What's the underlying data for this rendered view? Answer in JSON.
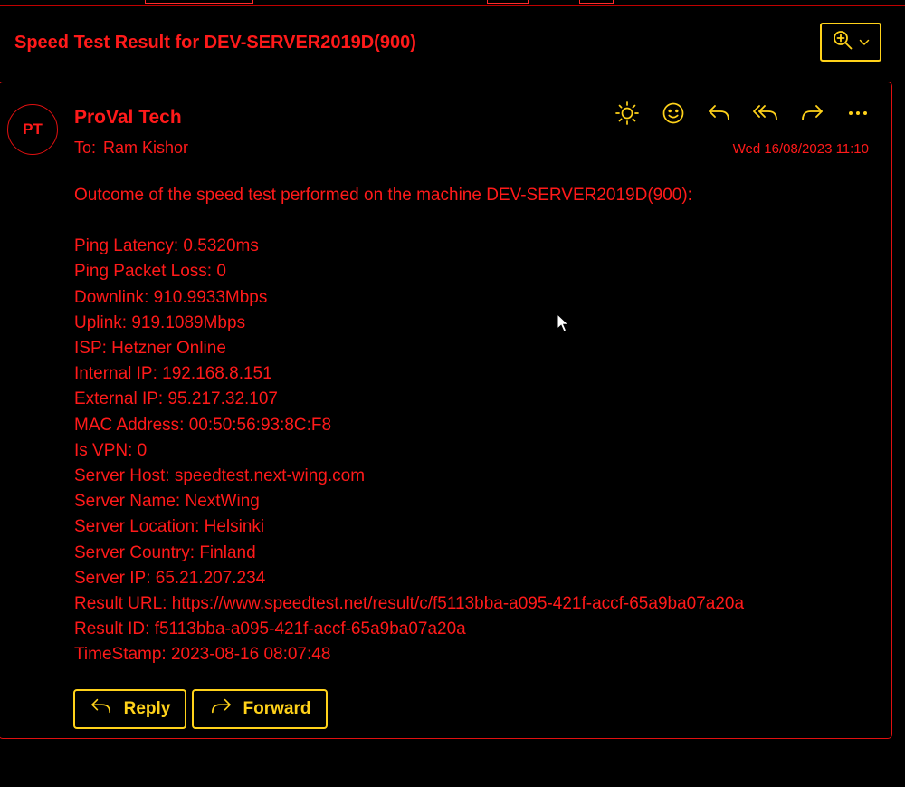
{
  "email": {
    "subject": "Speed Test Result for DEV-SERVER2019D(900)",
    "avatar_initials": "PT",
    "sender": "ProVal Tech",
    "to_label": "To:",
    "to_name": "Ram Kishor",
    "date": "Wed 16/08/2023 11:10",
    "intro": "Outcome of the speed test performed on the machine DEV-SERVER2019D(900):",
    "lines": [
      "Ping Latency: 0.5320ms",
      "Ping Packet Loss: 0",
      "Downlink: 910.9933Mbps",
      "Uplink: 919.1089Mbps",
      "ISP: Hetzner Online",
      "Internal IP: 192.168.8.151",
      "External IP: 95.217.32.107",
      "MAC Address: 00:50:56:93:8C:F8",
      "Is VPN: 0",
      "Server Host: speedtest.next-wing.com",
      "Server Name: NextWing",
      "Server Location: Helsinki",
      "Server Country: Finland",
      "Server IP: 65.21.207.234",
      "Result URL: https://www.speedtest.net/result/c/f5113bba-a095-421f-accf-65a9ba07a20a",
      "Result ID: f5113bba-a095-421f-accf-65a9ba07a20a",
      "TimeStamp: 2023-08-16 08:07:48"
    ]
  },
  "footer": {
    "reply_label": "Reply",
    "forward_label": "Forward"
  },
  "icons": {
    "zoom": "zoom-in-icon",
    "zoom_dropdown": "chevron-down-icon",
    "actions": [
      "sun-icon",
      "smiley-icon",
      "reply-icon",
      "reply-all-icon",
      "forward-icon",
      "more-icon"
    ]
  },
  "colors": {
    "text": "#ff1a1a",
    "border": "#e01010",
    "button_accent": "#ffd21a",
    "background": "#000000"
  }
}
